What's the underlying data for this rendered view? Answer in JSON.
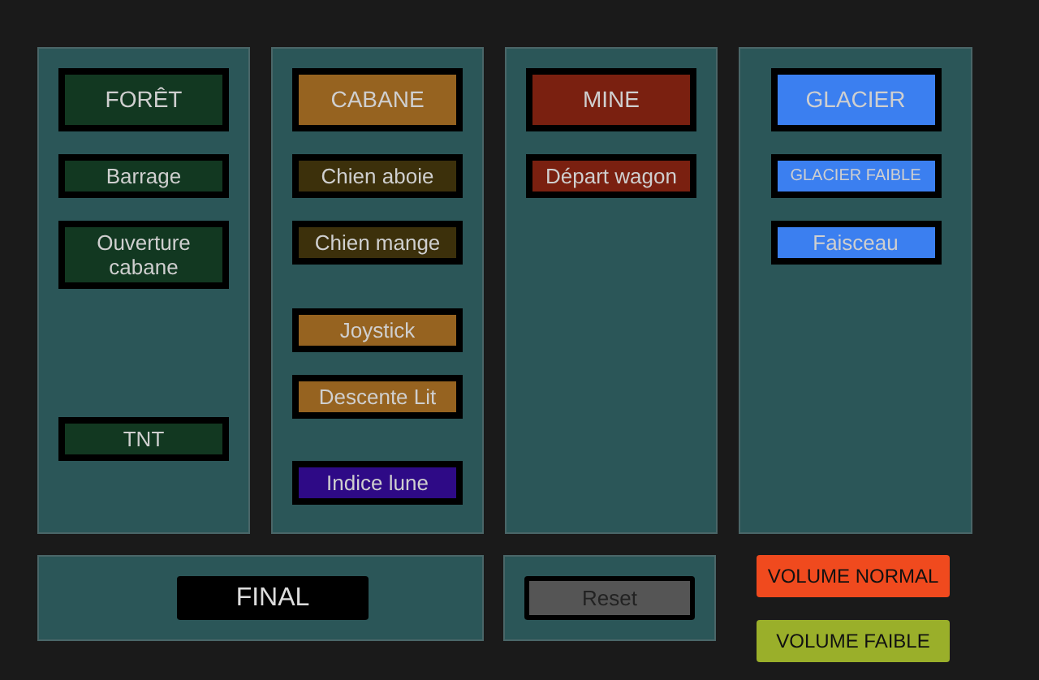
{
  "columns": [
    {
      "buttons": [
        {
          "label": "FORÊT",
          "kind": "header",
          "color": "#123821"
        },
        {
          "label": "Barrage",
          "kind": "item",
          "color": "#123821"
        },
        {
          "label": "Ouverture cabane",
          "kind": "item",
          "color": "#123821"
        },
        {
          "label": "TNT",
          "kind": "item",
          "color": "#123821"
        }
      ]
    },
    {
      "buttons": [
        {
          "label": "CABANE",
          "kind": "header",
          "color": "#966320"
        },
        {
          "label": "Chien aboie",
          "kind": "item",
          "color": "#3c300b"
        },
        {
          "label": "Chien mange",
          "kind": "item",
          "color": "#3c300b"
        },
        {
          "label": "Joystick",
          "kind": "item",
          "color": "#966320"
        },
        {
          "label": "Descente Lit",
          "kind": "item",
          "color": "#966320"
        },
        {
          "label": "Indice lune",
          "kind": "item",
          "color": "#2e0a86"
        }
      ]
    },
    {
      "buttons": [
        {
          "label": "MINE",
          "kind": "header",
          "color": "#7a2010"
        },
        {
          "label": "Départ wagon",
          "kind": "item",
          "color": "#7a2010"
        }
      ]
    },
    {
      "buttons": [
        {
          "label": "GLACIER",
          "kind": "header",
          "color": "#3b7ff0"
        },
        {
          "label": "GLACIER FAIBLE",
          "kind": "small",
          "color": "#3b7ff0"
        },
        {
          "label": "Faisceau",
          "kind": "item",
          "color": "#3b7ff0"
        }
      ]
    }
  ],
  "final_button": {
    "label": "FINAL"
  },
  "reset_button": {
    "label": "Reset"
  },
  "volume_buttons": [
    {
      "label": "VOLUME NORMAL",
      "color": "#f04a1e"
    },
    {
      "label": "VOLUME FAIBLE",
      "color": "#9aaf2a"
    }
  ]
}
